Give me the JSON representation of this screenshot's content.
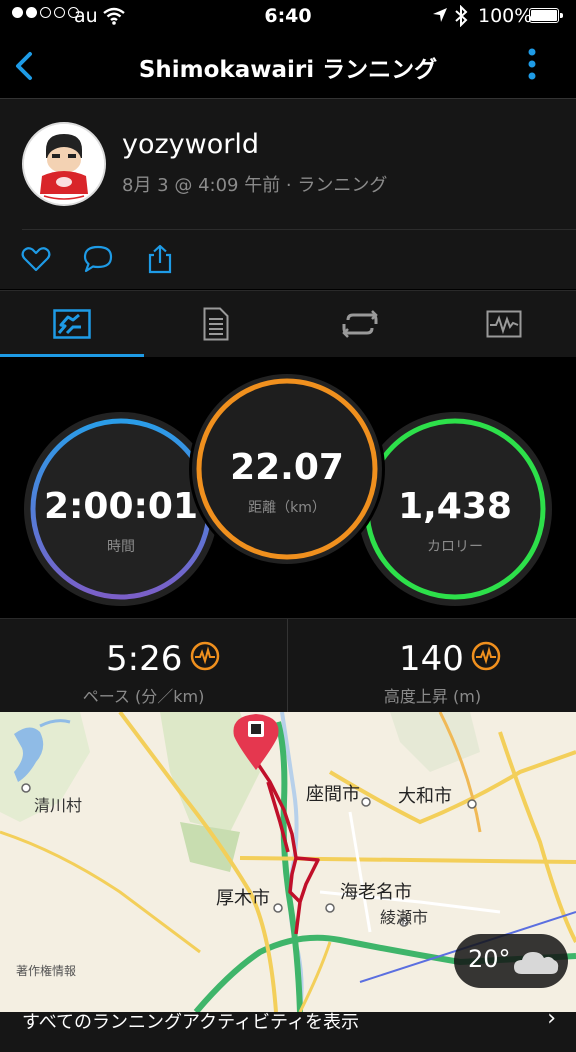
{
  "status_bar": {
    "carrier": "au",
    "time": "6:40",
    "battery_percent": "100%",
    "signal_bars_filled": 2,
    "signal_bars_total": 5
  },
  "nav": {
    "title": "Shimokawairi ランニング",
    "back_icon": "chevron-left-icon",
    "more_icon": "vertical-dots-icon"
  },
  "profile": {
    "username": "yozyworld",
    "meta": "8月 3 @ 4:09 午前 · ランニング"
  },
  "actions": [
    "heart-icon",
    "comment-icon",
    "share-icon"
  ],
  "tabs": [
    {
      "icon": "stats-icon",
      "active": true
    },
    {
      "icon": "details-icon",
      "active": false
    },
    {
      "icon": "laps-icon",
      "active": false
    },
    {
      "icon": "chart-icon",
      "active": false
    }
  ],
  "stats": {
    "time": {
      "value": "2:00:01",
      "label": "時間"
    },
    "distance": {
      "value": "22.07",
      "label": "距離（km）"
    },
    "calories": {
      "value": "1,438",
      "label": "カロリー"
    }
  },
  "metrics": {
    "pace": {
      "value": "5:26",
      "label": "ペース (分／km)"
    },
    "elevation": {
      "value": "140",
      "label": "高度上昇 (m)"
    }
  },
  "map": {
    "labels": {
      "kiyokawa": "清川村",
      "zama": "座間市",
      "yamato": "大和市",
      "atsugi": "厚木市",
      "ebina": "海老名市",
      "ayase": "綾瀬市"
    },
    "attribution": "著作権情報",
    "weather_temp": "20°"
  },
  "footer": {
    "link": "すべてのランニングアクティビティを表示"
  },
  "colors": {
    "accent": "#1e9be6",
    "time_ring": "#6a5fd6",
    "distance_ring": "#f0901e",
    "calories_ring": "#2de04a",
    "route": "#c0102a",
    "pin": "#e5374f"
  }
}
